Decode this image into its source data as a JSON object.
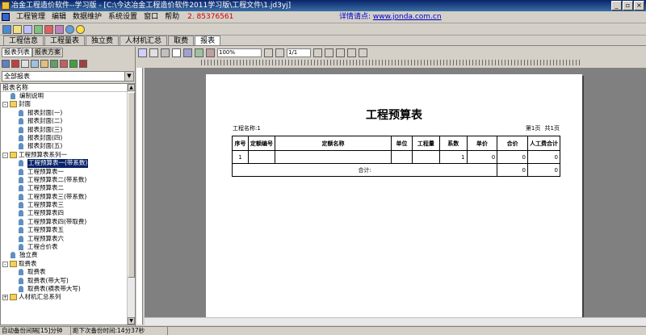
{
  "window": {
    "title": "冶金工程造价软件--学习版 - [C:\\今达冶金工程造价软件2011学习版\\工程文件\\1.jd3yj]",
    "buttons": [
      "_",
      "▫",
      "×"
    ]
  },
  "menu": {
    "items": [
      "工程管理",
      "编辑",
      "数据维护",
      "系统设置",
      "窗口",
      "帮助"
    ],
    "phone": "2. 85376561",
    "consult_label": "详情请点:",
    "consult_link": "www.jonda.com.cn"
  },
  "tabs": [
    "工程信息",
    "工程量表",
    "独立费",
    "人材机汇总",
    "取费",
    "报表"
  ],
  "active_tab": 5,
  "left": {
    "subtabs": [
      "报表列表",
      "报表方案"
    ],
    "filter": "全部报表",
    "tree_header": "报表名称",
    "tree": [
      {
        "label": "编制说明",
        "level": 1,
        "type": "rep"
      },
      {
        "label": "封面",
        "level": 0,
        "type": "folder",
        "exp": "-"
      },
      {
        "label": "报表封面(一)",
        "level": 2,
        "type": "rep"
      },
      {
        "label": "报表封面(二)",
        "level": 2,
        "type": "rep"
      },
      {
        "label": "报表封面(三)",
        "level": 2,
        "type": "rep"
      },
      {
        "label": "报表封面(四)",
        "level": 2,
        "type": "rep"
      },
      {
        "label": "报表封面(五)",
        "level": 2,
        "type": "rep"
      },
      {
        "label": "工程预算表系列一",
        "level": 0,
        "type": "folder",
        "exp": "-"
      },
      {
        "label": "工程预算表一(带系数)",
        "level": 2,
        "type": "rep",
        "selected": true
      },
      {
        "label": "工程预算表一",
        "level": 2,
        "type": "rep"
      },
      {
        "label": "工程预算表二(带系数)",
        "level": 2,
        "type": "rep"
      },
      {
        "label": "工程预算表二",
        "level": 2,
        "type": "rep"
      },
      {
        "label": "工程预算表三(带系数)",
        "level": 2,
        "type": "rep"
      },
      {
        "label": "工程预算表三",
        "level": 2,
        "type": "rep"
      },
      {
        "label": "工程预算表四",
        "level": 2,
        "type": "rep"
      },
      {
        "label": "工程预算表四(带取费)",
        "level": 2,
        "type": "rep"
      },
      {
        "label": "工程预算表五",
        "level": 2,
        "type": "rep"
      },
      {
        "label": "工程预算表六",
        "level": 2,
        "type": "rep"
      },
      {
        "label": "工程合价表",
        "level": 2,
        "type": "rep"
      },
      {
        "label": "独立费",
        "level": 1,
        "type": "rep"
      },
      {
        "label": "取费表",
        "level": 0,
        "type": "folder",
        "exp": "-"
      },
      {
        "label": "取费表",
        "level": 2,
        "type": "rep"
      },
      {
        "label": "取费表(带大写)",
        "level": 2,
        "type": "rep"
      },
      {
        "label": "取费表(横表带大写)",
        "level": 2,
        "type": "rep"
      },
      {
        "label": "人材机汇总系列",
        "level": 0,
        "type": "folder",
        "exp": "+"
      }
    ]
  },
  "preview": {
    "zoom": "100%",
    "page": "1/1",
    "report": {
      "title": "工程预算表",
      "project_label": "工程名称:1",
      "page_info": "第1页 共1页",
      "headers": [
        "序号",
        "定额编号",
        "定额名称",
        "单位",
        "工程量",
        "系数",
        "单价",
        "合价",
        "人工费合计"
      ],
      "rows": [
        [
          "1",
          "",
          "",
          "",
          "",
          "1",
          "0",
          "0",
          "0"
        ]
      ],
      "sum_label": "合计:",
      "sum_values": [
        "0",
        "0"
      ]
    }
  },
  "status": {
    "autosave": "自动备份间隔[15]分钟",
    "next": "距下次备份时间:14分37秒"
  }
}
